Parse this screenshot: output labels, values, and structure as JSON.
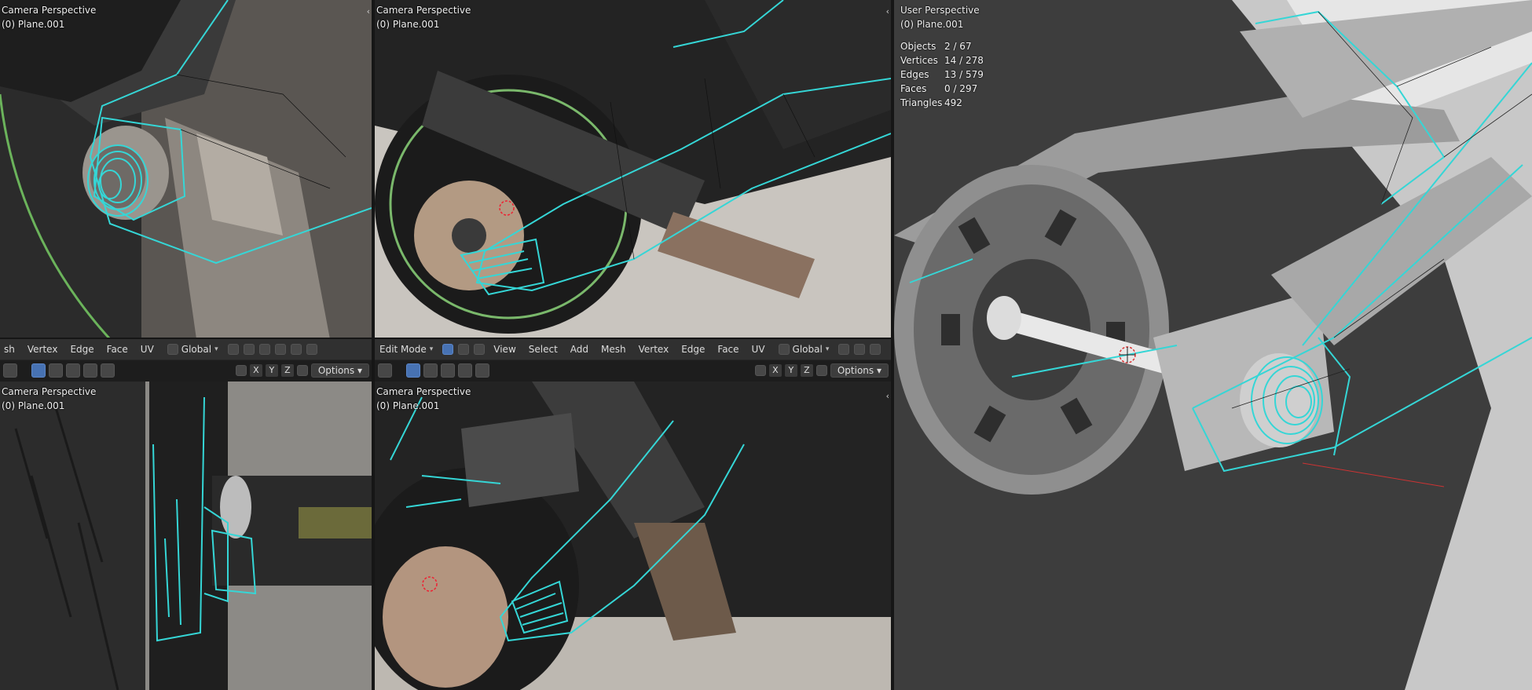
{
  "viewports": {
    "top_left": {
      "line1": "Camera Perspective",
      "line2": "(0) Plane.001"
    },
    "top_mid": {
      "line1": "Camera Perspective",
      "line2": "(0) Plane.001"
    },
    "bottom_left": {
      "line1": "Camera Perspective",
      "line2": "(0) Plane.001"
    },
    "bottom_mid": {
      "line1": "Camera Perspective",
      "line2": "(0) Plane.001"
    },
    "right": {
      "line1": "User Perspective",
      "line2": "(0) Plane.001"
    }
  },
  "stats": [
    {
      "label": "Objects",
      "value": "2 / 67"
    },
    {
      "label": "Vertices",
      "value": "14 / 278"
    },
    {
      "label": "Edges",
      "value": "13 / 579"
    },
    {
      "label": "Faces",
      "value": "0 / 297"
    },
    {
      "label": "Triangles",
      "value": "492"
    }
  ],
  "left_header": {
    "menu": [
      "sh",
      "Vertex",
      "Edge",
      "Face",
      "UV"
    ],
    "orientation": "Global"
  },
  "mid_header": {
    "mode": "Edit Mode",
    "menu": [
      "View",
      "Select",
      "Add",
      "Mesh",
      "Vertex",
      "Edge",
      "Face",
      "UV"
    ],
    "orientation": "Global"
  },
  "toolbar": {
    "x": "X",
    "y": "Y",
    "z": "Z",
    "options": "Options"
  },
  "icons": {
    "collapse": "‹"
  },
  "colors": {
    "wire": "#35d6d6",
    "bg": "#303030",
    "accent": "#4772b3"
  }
}
